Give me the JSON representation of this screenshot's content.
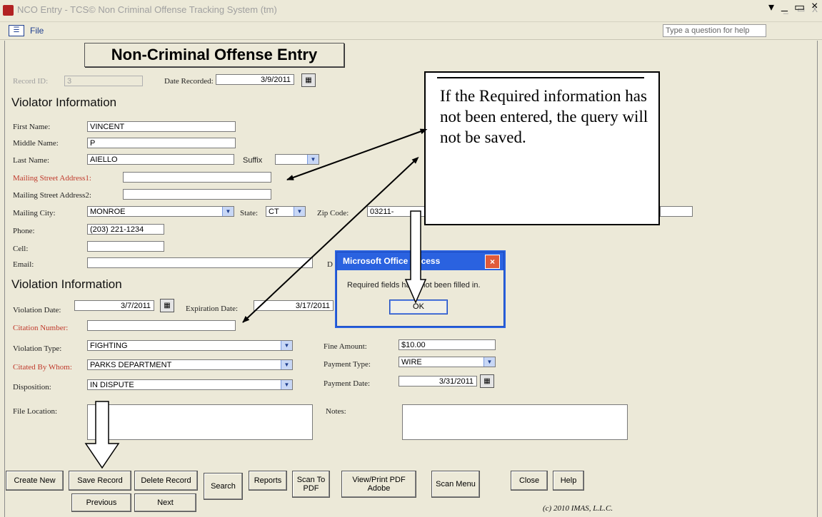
{
  "window": {
    "title": "NCO Entry - TCS© Non Criminal Offense Tracking System (tm)",
    "minimize": "_",
    "restore": "▭",
    "close": "X"
  },
  "menubar": {
    "file_label": "File",
    "help_placeholder": "Type a question for help",
    "doc_buttons": [
      "▾",
      "_",
      "▭",
      "×"
    ]
  },
  "form": {
    "title": "Non-Criminal Offense Entry",
    "record_id_label": "Record ID:",
    "record_id_value": "3",
    "date_recorded_label": "Date Recorded:",
    "date_recorded_value": "3/9/2011",
    "calendar_glyph": "▦"
  },
  "violator": {
    "heading": "Violator Information",
    "first_name_label": "First Name:",
    "first_name_value": "VINCENT",
    "middle_name_label": "Middle Name:",
    "middle_name_value": "P",
    "last_name_label": "Last Name:",
    "last_name_value": "AIELLO",
    "suffix_label": "Suffix",
    "suffix_value": "",
    "street1_label": "Mailing Street Address1:",
    "street1_value": "",
    "street2_label": "Mailing Street Address2:",
    "street2_value": "",
    "city_label": "Mailing City:",
    "city_value": "MONROE",
    "state_label": "State:",
    "state_value": "CT",
    "zip_label": "Zip Code:",
    "zip_value": "03211-",
    "phone_label": "Phone:",
    "phone_value": "(203) 221-1234",
    "cell_label": "Cell:",
    "cell_value": "",
    "email_label": "Email:",
    "email_value": "",
    "partial_label": "D"
  },
  "violation": {
    "heading": "Violation Information",
    "date_label": "Violation Date:",
    "date_value": "3/7/2011",
    "expiration_label": "Expiration Date:",
    "expiration_value": "3/17/2011",
    "citation_label": "Citation Number:",
    "citation_value": "",
    "type_label": "Violation Type:",
    "type_value": "FIGHTING",
    "citedby_label": "Citated By Whom:",
    "citedby_value": "PARKS DEPARTMENT",
    "disposition_label": "Disposition:",
    "disposition_value": "IN DISPUTE",
    "fine_label": "Fine Amount:",
    "fine_value": "$10.00",
    "payment_type_label": "Payment Type:",
    "payment_type_value": "WIRE",
    "payment_date_label": "Payment Date:",
    "payment_date_value": "3/31/2011",
    "file_location_label": "File Location:",
    "notes_label": "Notes:"
  },
  "buttons": {
    "create_new": "Create New",
    "save_record": "Save Record",
    "delete_record": "Delete Record",
    "search": "Search",
    "reports": "Reports",
    "scan_to_pdf": "Scan To PDF",
    "view_print_pdf": "View/Print PDF Adobe",
    "scan_menu": "Scan Menu",
    "close": "Close",
    "help": "Help",
    "previous": "Previous",
    "next": "Next"
  },
  "footer": {
    "copyright": "(c) 2010 IMAS, L.L.C."
  },
  "callout": {
    "text": "If the Required information has not been entered, the query will not be saved."
  },
  "dialog": {
    "title": "Microsoft Office Access",
    "message": "Required fields have not been filled in.",
    "ok_label": "OK",
    "close_glyph": "×"
  },
  "colors": {
    "required_label": "#c0392b",
    "dialog_title": "#2a62e0",
    "menu_text": "#1f3f8f"
  }
}
